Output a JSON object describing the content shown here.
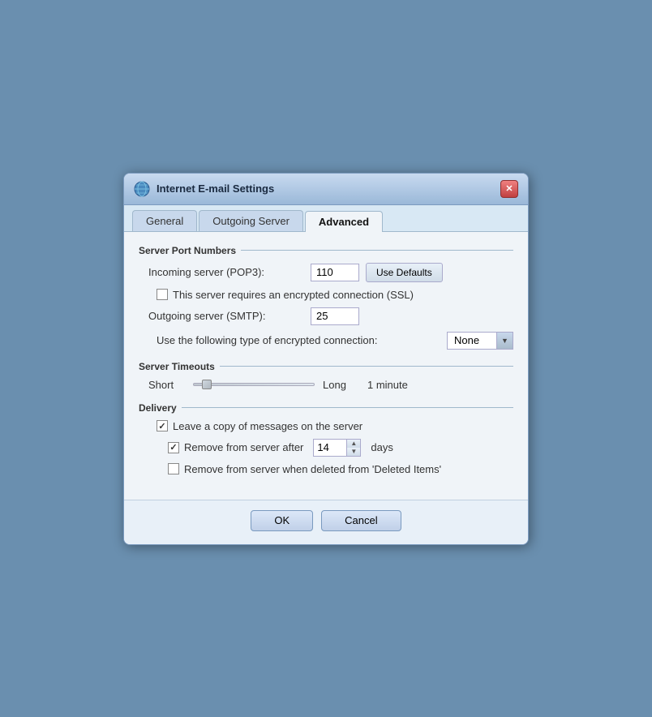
{
  "window": {
    "title": "Internet E-mail Settings",
    "close_label": "✕"
  },
  "tabs": [
    {
      "id": "general",
      "label": "General",
      "active": false
    },
    {
      "id": "outgoing",
      "label": "Outgoing Server",
      "active": false
    },
    {
      "id": "advanced",
      "label": "Advanced",
      "active": true
    }
  ],
  "advanced": {
    "server_ports_section": "Server Port Numbers",
    "incoming_label": "Incoming server (POP3):",
    "incoming_value": "110",
    "use_defaults_label": "Use Defaults",
    "ssl_label": "This server requires an encrypted connection (SSL)",
    "outgoing_label": "Outgoing server (SMTP):",
    "outgoing_value": "25",
    "encrypt_label": "Use the following type of encrypted connection:",
    "encrypt_value": "None",
    "server_timeouts_section": "Server Timeouts",
    "short_label": "Short",
    "long_label": "Long",
    "timeout_value": "1 minute",
    "delivery_section": "Delivery",
    "leave_copy_label": "Leave a copy of messages on the server",
    "remove_after_label": "Remove from server after",
    "remove_after_days": "14",
    "remove_after_unit": "days",
    "remove_deleted_label": "Remove from server when deleted from 'Deleted Items'"
  },
  "buttons": {
    "ok_label": "OK",
    "cancel_label": "Cancel"
  }
}
